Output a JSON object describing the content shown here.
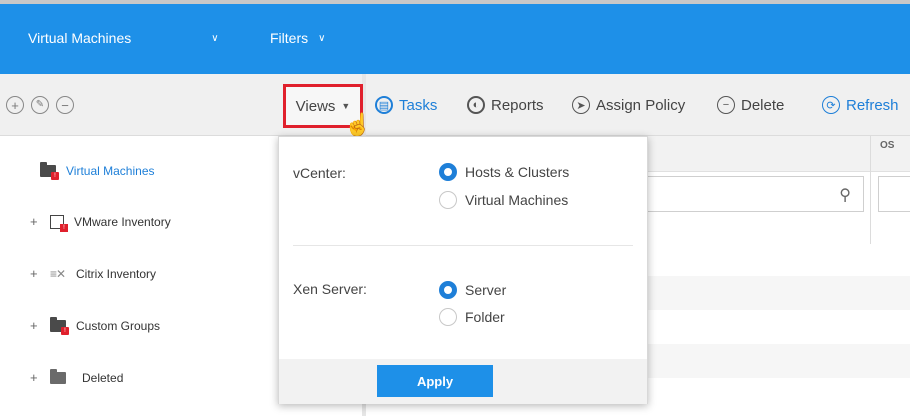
{
  "topbar": {
    "vm_dropdown": "Virtual Machines",
    "filters_dropdown": "Filters"
  },
  "toolbar": {
    "views": "Views",
    "tasks": "Tasks",
    "reports": "Reports",
    "assign_policy": "Assign Policy",
    "delete": "Delete",
    "refresh": "Refresh"
  },
  "tree": {
    "root": "Virtual Machines",
    "items": [
      {
        "label": "VMware Inventory",
        "icon": "vmware-icon"
      },
      {
        "label": "Citrix Inventory",
        "icon": "citrix-icon"
      },
      {
        "label": "Custom Groups",
        "icon": "folder-icon"
      },
      {
        "label": "Deleted",
        "icon": "folder-icon"
      }
    ]
  },
  "grid": {
    "os_header": "OS"
  },
  "views_panel": {
    "vcenter_label": "vCenter:",
    "vcenter_options": [
      {
        "label": "Hosts & Clusters",
        "selected": true
      },
      {
        "label": "Virtual Machines",
        "selected": false
      }
    ],
    "xen_label": "Xen Server:",
    "xen_options": [
      {
        "label": "Server",
        "selected": true
      },
      {
        "label": "Folder",
        "selected": false
      }
    ],
    "apply": "Apply"
  },
  "colors": {
    "brand_blue": "#1e90e8",
    "accent_blue": "#1e7fd8",
    "highlight_red": "#e0202c"
  }
}
